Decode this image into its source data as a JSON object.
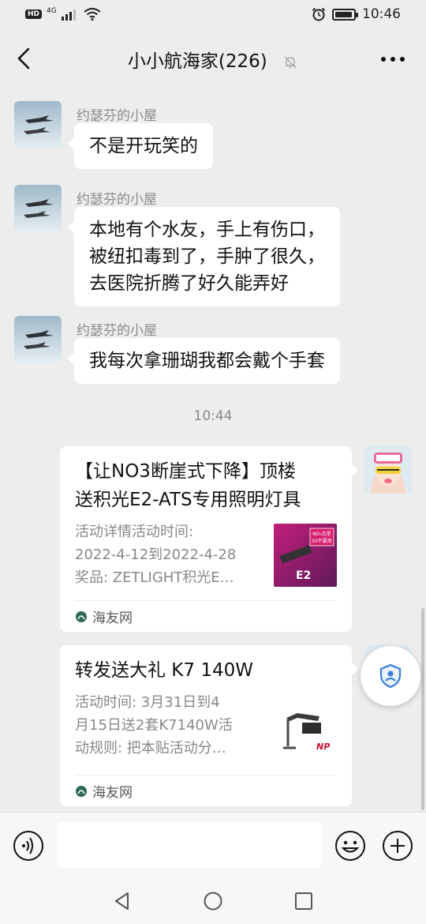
{
  "status_bar": {
    "network": "4G",
    "hd": "HD",
    "time": "10:46",
    "battery_level": 0.8
  },
  "header": {
    "title": "小小航海家(226)",
    "back_icon": "chevron-left-icon",
    "mute_icon": "bell-muted-icon",
    "more_icon": "more-dots-icon"
  },
  "messages": [
    {
      "sender": "约瑟芬的小屋",
      "text": "不是开玩笑的"
    },
    {
      "sender": "约瑟芬的小屋",
      "lines": [
        "本地有个水友，手上有伤口，",
        "被纽扣毒到了，手肿了很久，",
        "去医院折腾了好久能弄好"
      ]
    },
    {
      "sender": "约瑟芬的小屋",
      "text": "我每次拿珊瑚我都会戴个手套"
    }
  ],
  "timestamp": "10:44",
  "cards": [
    {
      "title_lines": [
        "【让NO3断崖式下降】顶楼",
        "送积光E2-ATS专用照明灯具"
      ],
      "desc_lines": [
        "活动详情活动时间:",
        "2022-4-12到2022-4-28",
        "奖品: ZETLIGHT积光E…"
      ],
      "thumb_text": "NO3克星\n50不要用",
      "thumb_tag": "E2",
      "source": "海友网"
    },
    {
      "title_lines": [
        "转发送大礼 K7 140W"
      ],
      "desc_lines": [
        "活动时间: 3月31日到4",
        "月15日送2套K7140W活",
        "动规则: 把本贴活动分…"
      ],
      "thumb_tag": "NP",
      "source": "海友网"
    }
  ],
  "input_bar": {
    "placeholder": "",
    "voice_icon": "voice-icon",
    "emoji_icon": "emoji-icon",
    "plus_icon": "plus-icon"
  },
  "colors": {
    "background": "#ededed",
    "bubble": "#ffffff",
    "meta_text": "#8a8a8a"
  }
}
